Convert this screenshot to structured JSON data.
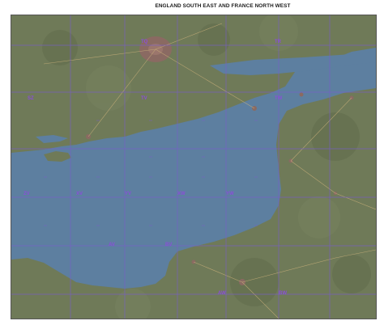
{
  "header": {
    "title": "ENGLAND SOUTH EAST AND FRANCE NORTH WEST"
  },
  "map": {
    "colors": {
      "sea": "#5d7fa0",
      "land": "#6f7a58",
      "urban": "#8a6a62",
      "grid": "#7a5ccc",
      "grid_label": "#8a4fd8"
    },
    "grid_square_labels": [
      "TQ",
      "TR",
      "TV",
      "TW",
      "SZ",
      "XV",
      "YV",
      "XW",
      "YW",
      "ZV",
      "AV",
      "BV",
      "AW",
      "BW"
    ]
  }
}
